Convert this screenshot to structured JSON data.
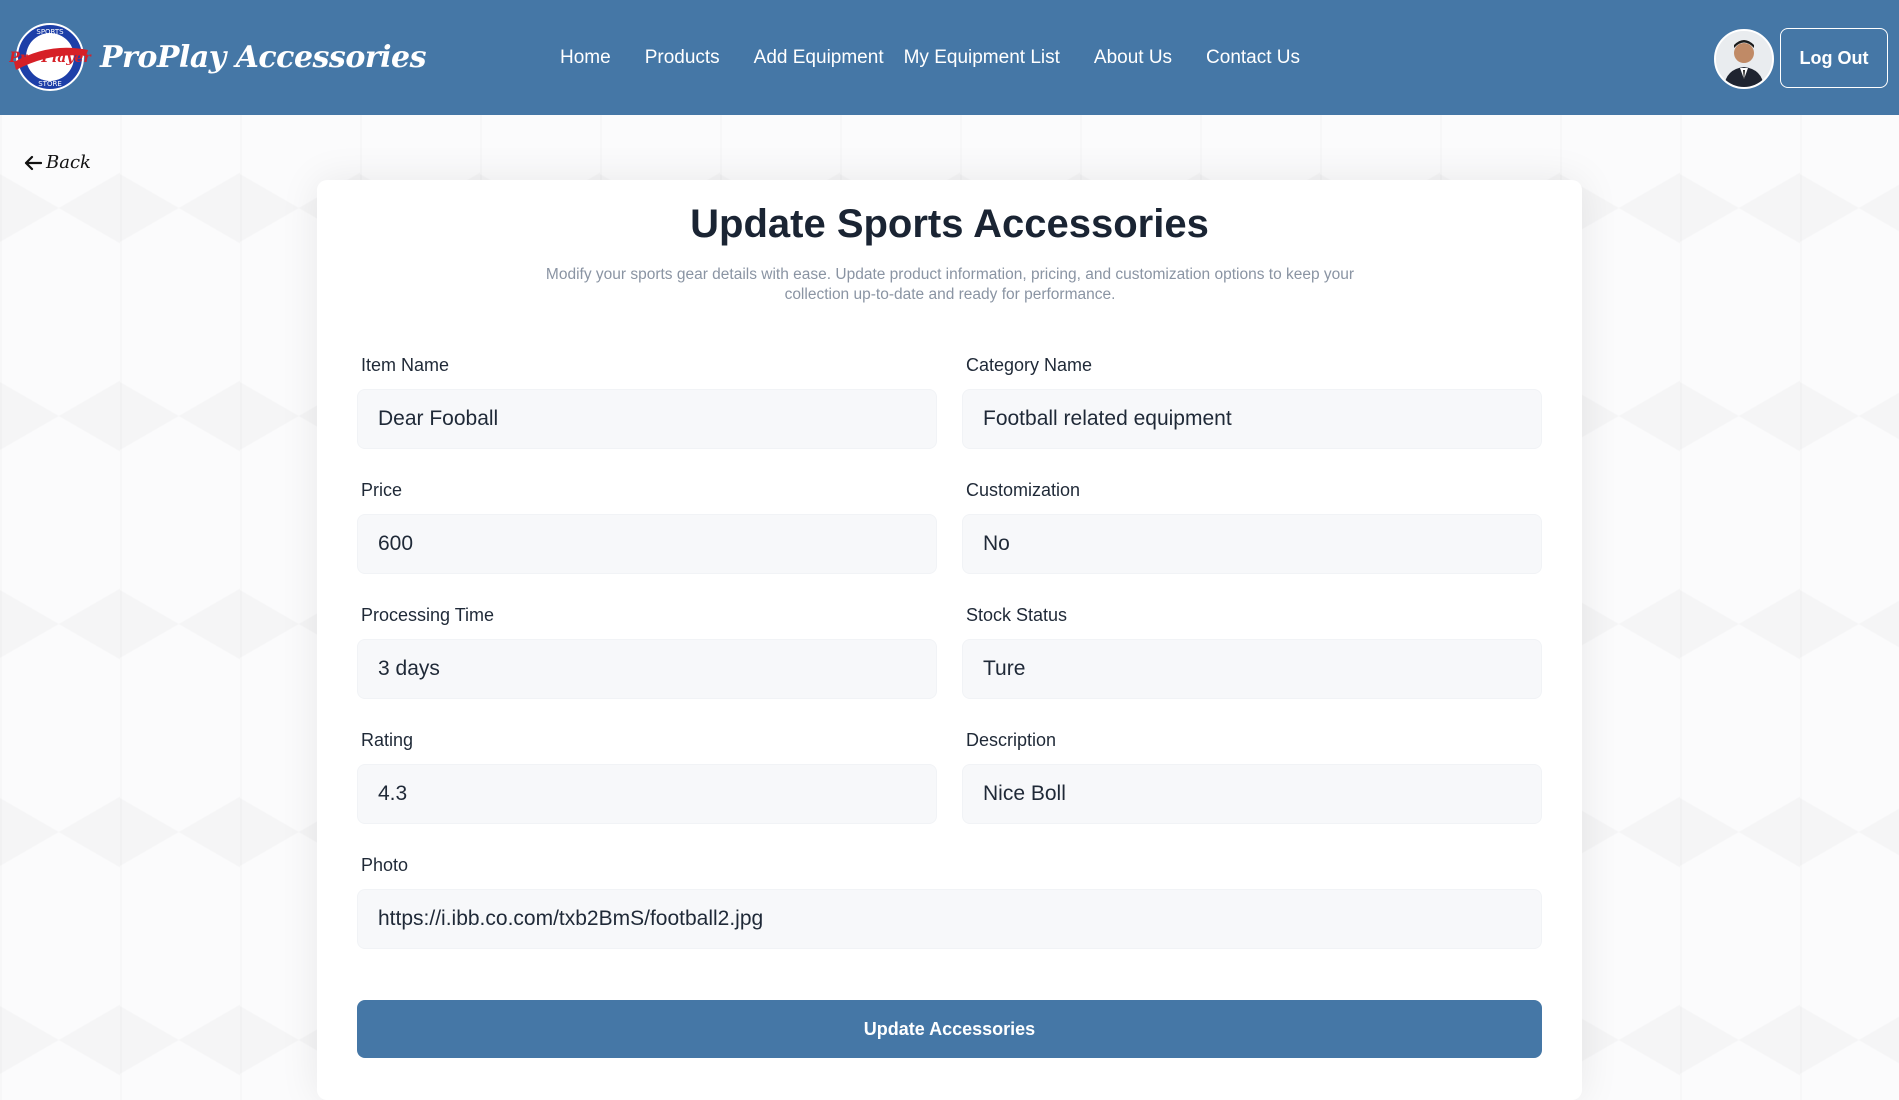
{
  "header": {
    "brand": "ProPlay Accessories",
    "logo": {
      "top_text": "SPORTS",
      "script_text": "Pro Player",
      "bottom_text": "STORE"
    },
    "nav": [
      "Home",
      "Products",
      "Add Equipment",
      "My Equipment List",
      "About Us",
      "Contact Us"
    ],
    "logout_label": "Log Out"
  },
  "back_label": "Back",
  "form": {
    "title": "Update Sports Accessories",
    "subtitle": "Modify your sports gear details with ease. Update product information, pricing, and customization options to keep your collection up-to-date and ready for performance.",
    "fields": {
      "item_name": {
        "label": "Item Name",
        "value": "Dear Fooball"
      },
      "category_name": {
        "label": "Category Name",
        "value": "Football related equipment"
      },
      "price": {
        "label": "Price",
        "value": "600"
      },
      "customization": {
        "label": "Customization",
        "value": "No"
      },
      "processing_time": {
        "label": "Processing Time",
        "value": "3 days"
      },
      "stock_status": {
        "label": "Stock Status",
        "value": "Ture"
      },
      "rating": {
        "label": "Rating",
        "value": "4.3"
      },
      "description": {
        "label": "Description",
        "value": "Nice Boll"
      },
      "photo": {
        "label": "Photo",
        "value": "https://i.ibb.co.com/txb2BmS/football2.jpg"
      }
    },
    "submit_label": "Update Accessories"
  },
  "colors": {
    "primary": "#4577a6",
    "input_bg": "#f7f8fa",
    "title": "#1a2433",
    "subtitle": "#8a94a3"
  }
}
